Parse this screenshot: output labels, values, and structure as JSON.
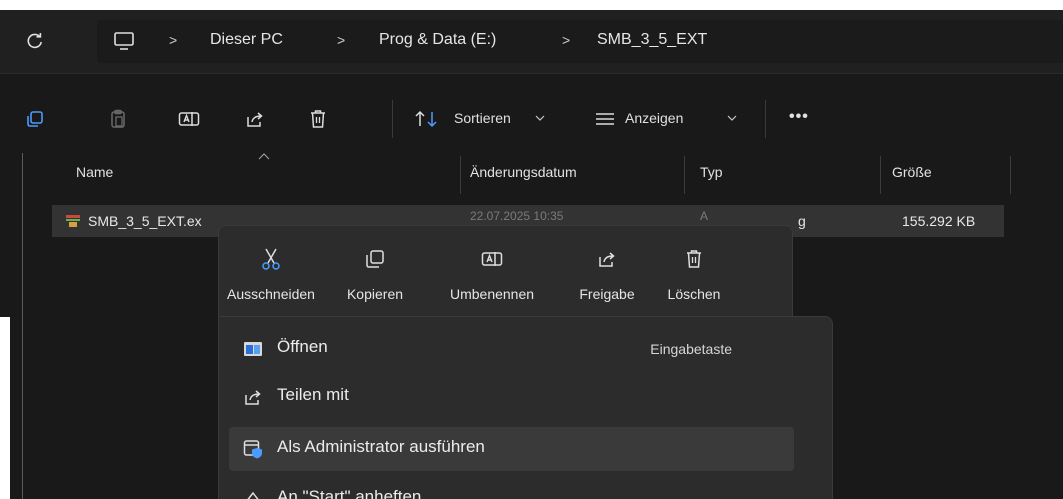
{
  "address_bar": {
    "refresh_icon": "refresh-icon",
    "pc_icon": "monitor-icon",
    "breadcrumbs": [
      "Dieser PC",
      "Prog & Data (E:)",
      "SMB_3_5_EXT"
    ],
    "separator": ">"
  },
  "command_bar": {
    "new_icon": "new-item-icon",
    "buttons": [
      {
        "name": "copy",
        "icon": "copy-icon"
      },
      {
        "name": "paste",
        "icon": "paste-icon"
      },
      {
        "name": "rename",
        "icon": "rename-icon"
      },
      {
        "name": "share",
        "icon": "share-icon"
      },
      {
        "name": "delete",
        "icon": "trash-icon"
      }
    ],
    "sort_label": "Sortieren",
    "view_label": "Anzeigen",
    "more_label": "•••"
  },
  "columns": {
    "name": "Name",
    "date": "Änderungsdatum",
    "type": "Typ",
    "size": "Größe"
  },
  "file": {
    "name": "SMB_3_5_EXT.ex",
    "date": "22.07.2025 10:35",
    "type_visible": "g",
    "type_prefix_visible": "A",
    "size": "155.292 KB"
  },
  "context_menu": {
    "quick_actions": [
      {
        "label": "Ausschneiden",
        "icon": "scissors-icon"
      },
      {
        "label": "Kopieren",
        "icon": "copy-icon"
      },
      {
        "label": "Umbenennen",
        "icon": "rename-icon"
      },
      {
        "label": "Freigabe",
        "icon": "share-icon"
      },
      {
        "label": "Löschen",
        "icon": "trash-icon"
      }
    ],
    "items": [
      {
        "label": "Öffnen",
        "shortcut": "Eingabetaste",
        "icon": "open-window-icon"
      },
      {
        "label": "Teilen mit",
        "icon": "share-icon"
      },
      {
        "label": "Als Administrator ausführen",
        "icon": "admin-shield-icon"
      },
      {
        "label": "An \"Start\" anheften",
        "icon": "pin-icon"
      }
    ]
  },
  "colors": {
    "background": "#191919",
    "toolbar": "#202020",
    "menu": "#2c2c2c",
    "hover": "#3a3a3a",
    "accent_blue": "#4a9bff"
  }
}
